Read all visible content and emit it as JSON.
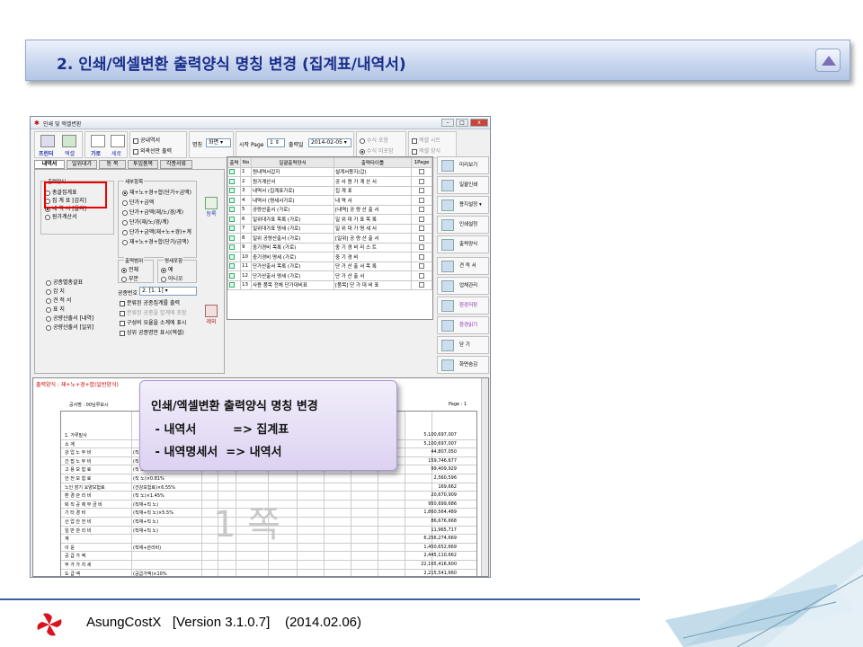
{
  "slide": {
    "title": "2. 인쇄/엑셀변환 출력양식 명칭 변경 (집계표/내역서)",
    "footer": "AsungCostX   [Version 3.1.0.7]    (2014.02.06)"
  },
  "window": {
    "title": "인쇄 및 엑셀변환",
    "toolbar": {
      "print": "프린터",
      "excel": "엑셀",
      "landscape": "가로",
      "portrait": "세로",
      "chk_bidding": "공내역서",
      "chk_printselect": "외곽선만 출력",
      "label_name": "명칭",
      "name_value": "화면",
      "label_startpage": "시작 Page",
      "startpage_value": "1",
      "label_outdate": "출력일",
      "outdate_value": "2014-02-05",
      "radio_a": "수식 포함",
      "radio_b": "수식 미포함",
      "chk_c": "엑셀 시트",
      "chk_d": "엑셀 양식"
    },
    "tabs": [
      "내역서",
      "일위대가",
      "동 목",
      "투입품목",
      "각종서류"
    ],
    "left": {
      "group_output": "출력양식",
      "output_options": [
        "총괄집계표",
        "집 계 표 [갑지]",
        "내 역 서 [을지]",
        "원가계산서"
      ],
      "group_detail": "세부항목",
      "detail_options": [
        "재+노+경+합(단가+금액)",
        "단가+금액",
        "단가+금액(재/노/경/계)",
        "단가(재/노/경/계)",
        "단가+금액(재+노+경)+계",
        "재+노+경+합(단가/금액)"
      ],
      "register": "등록",
      "remove": "제외",
      "group_range": "출력범위",
      "range_all": "전체",
      "range_part": "부분",
      "group_tax": "명세포함",
      "tax_yes": "예",
      "tax_no": "아니오",
      "other_options": [
        "공종별총괄표",
        "갑 지",
        "견 적 서",
        "표 지",
        "공량산출서 [내역]",
        "공량산출서 [일위]"
      ],
      "label_code": "공종번호",
      "code_value": "2. [1. 1]",
      "extra_checks": [
        "분류된 공종집계를 출력",
        "분류된 공종을 합계에 포함",
        "구성비 요율을 소계에 표시",
        "상위 공종명만 표시(엑셀)"
      ]
    },
    "grid": {
      "headers": [
        "출력",
        "No",
        "일괄출력양식",
        "출력타이틀",
        "1Page"
      ],
      "rows": [
        {
          "no": "1",
          "form": "원내역서갑지",
          "title": "설계서용지(갑)"
        },
        {
          "no": "2",
          "form": "원가계산서",
          "title": "공 사 원 가 계 산 서"
        },
        {
          "no": "3",
          "form": "내역서 (집계표가로)",
          "title": "집        계        표"
        },
        {
          "no": "4",
          "form": "내역서 (명세서가로)",
          "title": "내        역        서"
        },
        {
          "no": "5",
          "form": "공량산출서 (가로)",
          "title": "[내역]  공 량 산 출 서"
        },
        {
          "no": "6",
          "form": "일위대가표 목록 (가로)",
          "title": "일 위 대 가 표 목 록"
        },
        {
          "no": "7",
          "form": "일위대가표 명세 (가로)",
          "title": "일 위 대 가 명 세 서"
        },
        {
          "no": "8",
          "form": "일위 공량산출서 (가로)",
          "title": "[일위]  공 량 산 출 서"
        },
        {
          "no": "9",
          "form": "중기경비 목록 (가로)",
          "title": "중 기 경 비 리 스 트"
        },
        {
          "no": "10",
          "form": "중기경비 명세 (가로)",
          "title": "중    기    경    비"
        },
        {
          "no": "11",
          "form": "단가산출서 목록 (가로)",
          "title": "단 가 산 출 서 목 록"
        },
        {
          "no": "12",
          "form": "단가산출서 명세 (가로)",
          "title": "단    가    산    출    서"
        },
        {
          "no": "13",
          "form": "사용 품목 전체 단가대비표",
          "title": "[품목]  단 가 대 비 표"
        }
      ]
    },
    "side_buttons": [
      "미리보기",
      "일괄인쇄",
      "용지설정 ▾",
      "인쇄설정",
      "출력양식",
      "견 적 서",
      "업체관리",
      "환경저장",
      "환경읽기",
      "닫    기",
      "화면숨김"
    ],
    "preview": {
      "title": "출력양식 : 재+노+경+합(일반양식)",
      "sheet_label": "공사명 : 00님루묘시",
      "page_label": "Page :   1",
      "watermark": "1 쪽",
      "rows": [
        {
          "a": "1. 가루밑사",
          "b": "",
          "v": "5,100,697,007"
        },
        {
          "a": "소 계",
          "b": "",
          "v": "5,100,697,007"
        },
        {
          "a": "강 업 노 무 비",
          "b": "(직 노)",
          "v": "44,807,050"
        },
        {
          "a": "간 접 노 무 비",
          "b": "(직 노)",
          "v": "159,746,677"
        },
        {
          "a": "고 용 보 험 료",
          "b": "(직 노)",
          "v": "99,409,929"
        },
        {
          "a": "안 전 보 험 료",
          "b": "(직 노)×0.81%",
          "v": "2,560,596"
        },
        {
          "a": "노인 장기 요양보험료",
          "b": "(건강보험료)×6.55%",
          "v": "169,662"
        },
        {
          "a": "환 경 관 리 비",
          "b": "(직 노)×1.45%",
          "v": "20,670,909"
        },
        {
          "a": "퇴 직 공 제 부 금 비",
          "b": "(직재+직 노)",
          "v": "950,699,686"
        },
        {
          "a": "기 타 경 비",
          "b": "(직재+직 노)×5.5%",
          "v": "1,860,564,489"
        },
        {
          "a": "산 업 안 전 비",
          "b": "(직재+직 노)",
          "v": "86,676,668"
        },
        {
          "a": "일 반 관 리 비",
          "b": "(직재+직 노)",
          "v": "11,965,717"
        },
        {
          "a": "계",
          "b": "",
          "v": "6,256,274,669"
        },
        {
          "a": "이 윤",
          "b": "(직재+관리비)",
          "v": "1,450,652,669"
        },
        {
          "a": "공 급 가 액",
          "b": "",
          "v": "2,445,110,662"
        },
        {
          "a": "부 가 가 치 세",
          "b": "",
          "v": "22,165,416,600"
        },
        {
          "a": "도 급 액",
          "b": "(공급가액)×10%",
          "v": "2,215,541,660"
        }
      ]
    }
  },
  "callout": {
    "title": "인쇄/엑셀변환 출력양식 명칭 변경",
    "line1": " - 내역서         => 집계표",
    "line2": " - 내역명세서  => 내역서"
  }
}
